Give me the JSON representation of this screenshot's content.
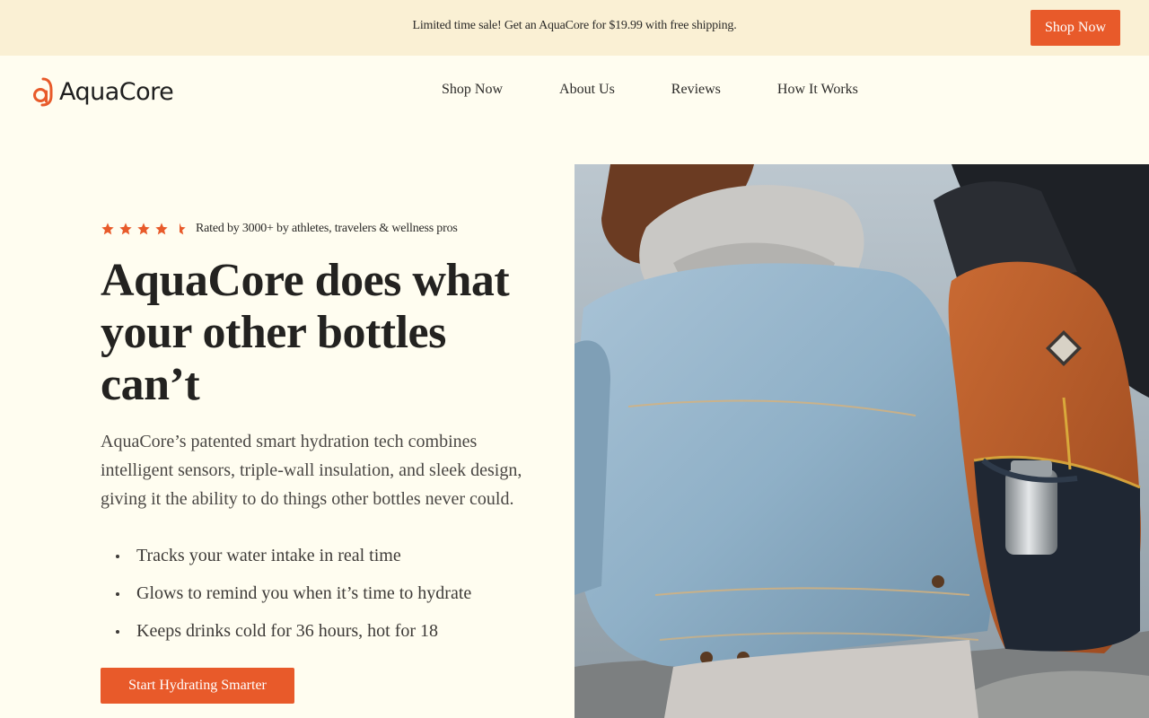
{
  "promo": {
    "text": "Limited time sale! Get an AquaCore for $19.99 with free shipping.",
    "button_label": "Shop Now"
  },
  "brand": {
    "name": "AquaCore",
    "accent_color": "#E85A2A",
    "background_color": "#FFFDF0",
    "promo_bg_color": "#FAF0D4"
  },
  "nav": {
    "items": [
      {
        "label": "Shop Now"
      },
      {
        "label": "About Us"
      },
      {
        "label": "Reviews"
      },
      {
        "label": "How It Works"
      }
    ]
  },
  "hero": {
    "rating": {
      "stars": 4.5,
      "max_stars": 5,
      "text": "Rated by 3000+ by athletes, travelers & wellness pros"
    },
    "headline": "AquaCore does what your other bottles can’t",
    "body": "AquaCore’s patented smart hydration tech combines intelligent sensors, triple-wall insulation, and sleek design, giving it the ability to do things other bottles never could.",
    "features": [
      "Tracks your water intake in real time",
      "Glows to remind you when it’s time to hydrate",
      "Keeps drinks cold for 36 hours, hot for 18"
    ],
    "cta_label": "Start Hydrating Smarter",
    "image_icon": "photo-person-with-backpack-and-bottle"
  }
}
